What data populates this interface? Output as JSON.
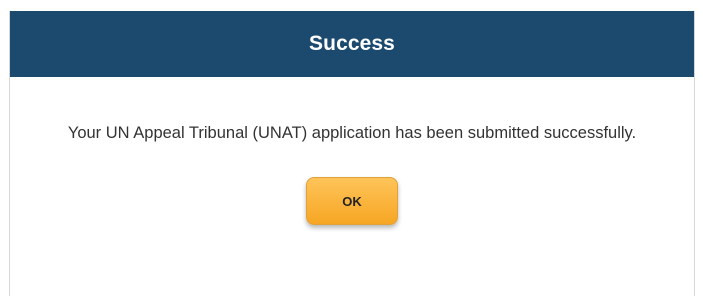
{
  "dialog": {
    "title": "Success",
    "message": "Your UN Appeal Tribunal (UNAT) application has been submitted successfully.",
    "ok_label": "OK",
    "colors": {
      "header_background": "#1c4a6e",
      "header_text": "#ffffff",
      "button_background": "#f6a623"
    }
  }
}
